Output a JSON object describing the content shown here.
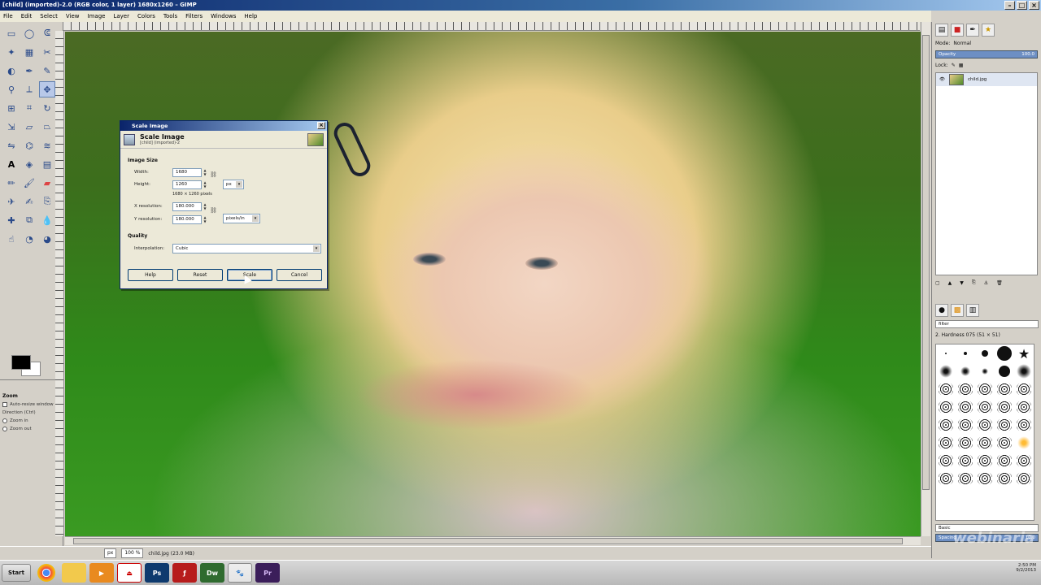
{
  "window": {
    "title": "[child] (imported)-2.0 (RGB color, 1 layer) 1680x1260 – GIMP"
  },
  "menu": [
    "File",
    "Edit",
    "Select",
    "View",
    "Image",
    "Layer",
    "Colors",
    "Tools",
    "Filters",
    "Windows",
    "Help"
  ],
  "toolbox": {
    "tools": [
      "rect-select-icon",
      "ellipse-select-icon",
      "lasso-icon",
      "fuzzy-select-icon",
      "select-by-color-icon",
      "scissors-icon",
      "foreground-select-icon",
      "paths-icon",
      "color-picker-icon",
      "zoom-icon",
      "measure-icon",
      "move-icon",
      "align-icon",
      "crop-icon",
      "rotate-icon",
      "scale-icon",
      "shear-icon",
      "perspective-icon",
      "flip-icon",
      "cage-icon",
      "warp-icon",
      "text-icon",
      "bucket-fill-icon",
      "blend-icon",
      "pencil-icon",
      "paintbrush-icon",
      "eraser-icon",
      "airbrush-icon",
      "ink-icon",
      "clone-icon",
      "heal-icon",
      "perspective-clone-icon",
      "blur-icon",
      "smudge-icon",
      "dodge-icon",
      "burn-icon"
    ],
    "options": {
      "title": "Zoom",
      "auto_resize": "Auto-resize window",
      "direction_label": "Direction (Ctrl)",
      "zoom_in": "Zoom in",
      "zoom_out": "Zoom out"
    }
  },
  "status": {
    "unit": "px",
    "zoom": "100 %",
    "info": "child.jpg (23.0 MB)"
  },
  "dock": {
    "mode_label": "Mode:",
    "mode_value": "Normal",
    "opacity_label": "Opacity",
    "opacity_value": "100.0",
    "lock_label": "Lock:",
    "layer_name": "child.jpg",
    "filter_placeholder": "filter",
    "brush_label": "2. Hardness 075 (51 × 51)",
    "brush_set": "Basic",
    "spacing_label": "Spacing",
    "spacing_value": "10.0"
  },
  "dialog": {
    "title": "Scale Image",
    "header_title": "Scale Image",
    "header_sub": "[child] (imported)-2",
    "image_size_label": "Image Size",
    "width_label": "Width:",
    "width_value": "1680",
    "height_label": "Height:",
    "height_value": "1260",
    "size_note": "1680 × 1260 pixels",
    "unit": "px",
    "xres_label": "X resolution:",
    "xres_value": "180.000",
    "yres_label": "Y resolution:",
    "yres_value": "180.000",
    "res_unit": "pixels/in",
    "quality_label": "Quality",
    "interp_label": "Interpolation:",
    "interp_value": "Cubic",
    "btn_help": "Help",
    "btn_reset": "Reset",
    "btn_scale": "Scale",
    "btn_cancel": "Cancel"
  },
  "taskbar": {
    "start": "Start",
    "apps": [
      "chrome-icon",
      "explorer-icon",
      "media-icon",
      "pdf-icon",
      "Ps",
      "flash-icon",
      "Dw",
      "gimp-icon",
      "Pr"
    ],
    "time": "2:50 PM",
    "date": "9/2/2013"
  },
  "watermark": "webinaria"
}
